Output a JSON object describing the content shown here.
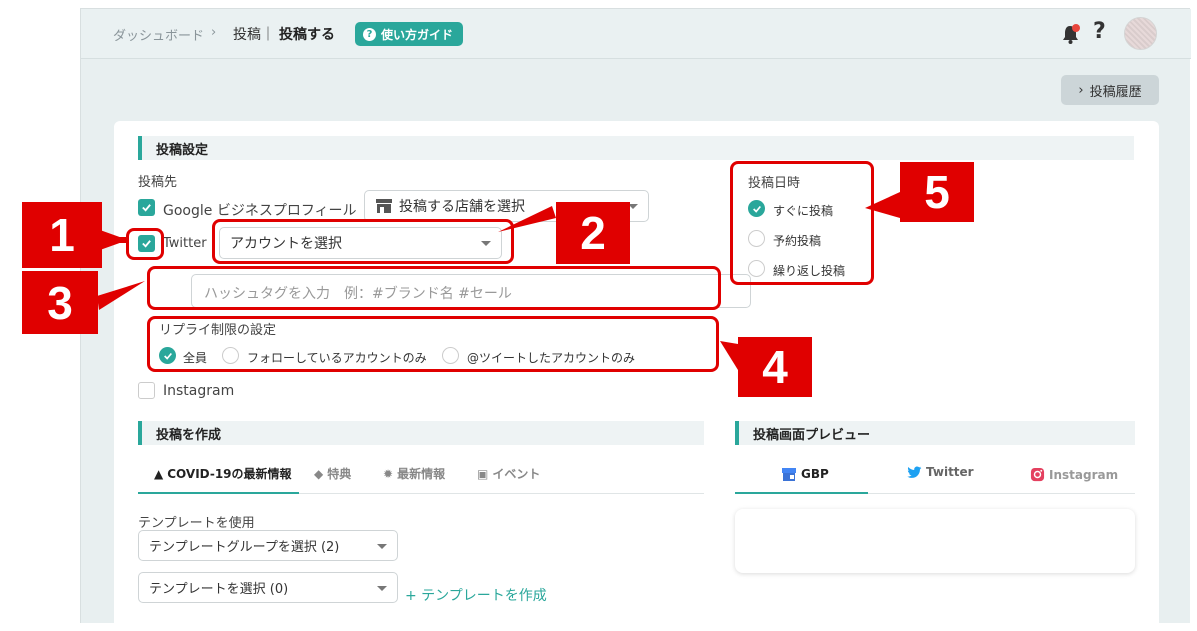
{
  "breadcrumb": {
    "dashboard": "ダッシュボード",
    "sep": "›",
    "posts": "投稿｜",
    "current": "投稿する"
  },
  "guide_button": "使い方ガイド",
  "history_button": "投稿履歴",
  "post_settings": {
    "title": "投稿設定",
    "destination_label": "投稿先",
    "google": {
      "label": "Google ビジネスプロフィール",
      "checked": true,
      "select": "投稿する店舗を選択"
    },
    "twitter": {
      "label": "Twitter",
      "checked": true,
      "select": "アカウントを選択"
    },
    "hashtag_placeholder": "ハッシュタグを入力　例：#ブランド名 #セール",
    "reply_limit": {
      "title": "リプライ制限の設定",
      "options": [
        "全員",
        "フォローしているアカウントのみ",
        "@ツイートしたアカウントのみ"
      ],
      "selected": "全員"
    },
    "instagram": {
      "label": "Instagram",
      "checked": false
    }
  },
  "post_time": {
    "title": "投稿日時",
    "options": [
      "すぐに投稿",
      "予約投稿",
      "繰り返し投稿"
    ],
    "selected": "すぐに投稿"
  },
  "create_post": {
    "title": "投稿を作成",
    "tabs": [
      "COVID-19の最新情報",
      "特典",
      "最新情報",
      "イベント"
    ],
    "active_tab": "COVID-19の最新情報",
    "template_label": "テンプレートを使用",
    "template_group_select": "テンプレートグループを選択 (2)",
    "template_select": "テンプレートを選択 (0)",
    "create_template_link": "+ テンプレートを作成"
  },
  "preview": {
    "title": "投稿画面プレビュー",
    "tabs": [
      "GBP",
      "Twitter",
      "Instagram"
    ],
    "active_tab": "GBP"
  },
  "annotations": [
    "1",
    "2",
    "3",
    "4",
    "5"
  ],
  "colors": {
    "accent": "#2aa79b",
    "annotation": "#e00000",
    "background": "#e8eff0"
  }
}
